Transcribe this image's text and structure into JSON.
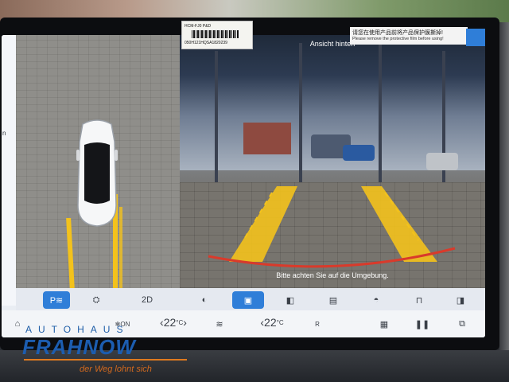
{
  "camera": {
    "view_title": "Ansicht hinten",
    "hint": "Bitte achten Sie auf die Umgebung.",
    "sticker": {
      "line1": "HCM-FJ0 P&D",
      "line2": "050H121HQSA1820239"
    },
    "protect_notice_cn": "请您在使用产品前将产品保护膜撕掉!",
    "protect_notice_en": "Please remove the protective film before using!"
  },
  "side_panel": {
    "text": "n"
  },
  "camera_controls": [
    {
      "name": "park-assist-button",
      "glyph": "P≋",
      "active": true
    },
    {
      "name": "car-front-view-button",
      "glyph": "⛭",
      "active": false
    },
    {
      "name": "view-2d-button",
      "glyph": "2D",
      "active": false
    },
    {
      "name": "cam-left-side-button",
      "glyph": "◐",
      "active": false
    },
    {
      "name": "cam-rear-button",
      "glyph": "▣",
      "active": true
    },
    {
      "name": "cam-left-button",
      "glyph": "◧",
      "active": false
    },
    {
      "name": "cam-top-button",
      "glyph": "▤",
      "active": false
    },
    {
      "name": "cam-front-button",
      "glyph": "◓",
      "active": false
    },
    {
      "name": "cam-wheel-button",
      "glyph": "⊓",
      "active": false
    },
    {
      "name": "cam-right-button",
      "glyph": "◨",
      "active": false
    }
  ],
  "climate": {
    "home_label": "⌂",
    "fan_label": "ON",
    "temp_left": "22",
    "temp_left_unit": "°C",
    "temp_right": "22",
    "temp_right_unit": "°C",
    "seat_heat_label": "≋",
    "rear_defrost_label": "R",
    "grid_label": "▦",
    "pause_label": "❚❚",
    "window_label": "⧉"
  },
  "watermark": {
    "line1": "AUTOHAUS",
    "line2": "FRAHNOW",
    "line3": "der Weg lohnt sich"
  },
  "colors": {
    "accent": "#2f7ed8",
    "guide_yellow": "#f3c21c",
    "guide_red": "#d93a2b"
  }
}
